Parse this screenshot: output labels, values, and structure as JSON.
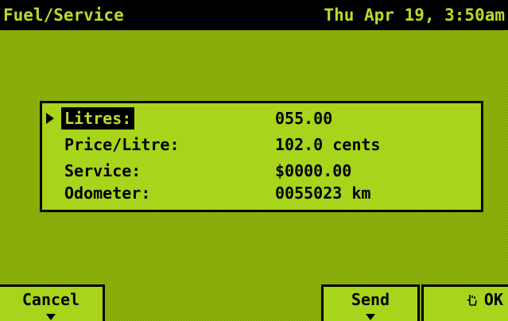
{
  "header": {
    "title": "Fuel/Service",
    "datetime": "Thu Apr 19, 3:50am"
  },
  "form": {
    "fields": [
      {
        "label": "Litres:",
        "value": "055.00",
        "selected": true
      },
      {
        "label": "Price/Litre:",
        "value": "102.0 cents",
        "selected": false
      },
      {
        "label": "Service:",
        "value": "$0000.00",
        "selected": false
      },
      {
        "label": "Odometer:",
        "value": "0055023 km",
        "selected": false
      }
    ]
  },
  "softkeys": {
    "cancel_label": "Cancel",
    "send_label": "Send",
    "ok_label": "OK",
    "ok_icon": "hand-pointer-icon"
  },
  "colors": {
    "lcd_green": "#a8d41c",
    "lcd_dark": "#000000",
    "inverse_text": "#b8dc2c"
  }
}
